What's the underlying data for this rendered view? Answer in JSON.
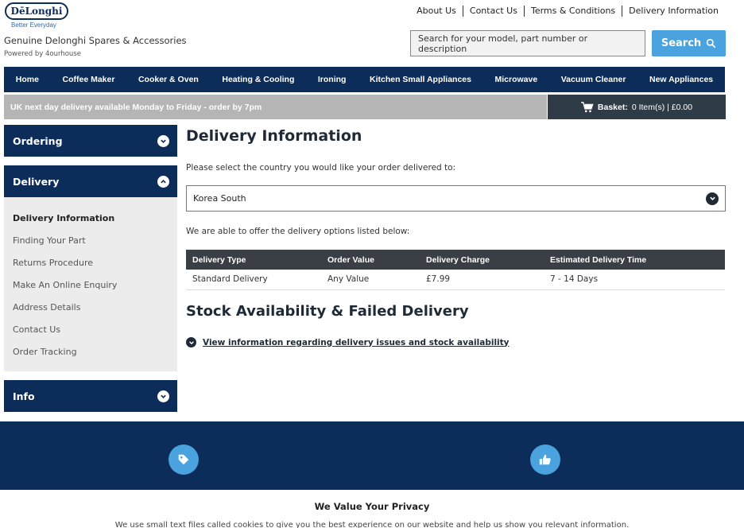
{
  "brand": {
    "logo_text": "DēLonghi",
    "tagline": "Better Everyday",
    "site_name": "Genuine Delonghi Spares & Accessories",
    "powered_by": "Powered by 4ourhouse"
  },
  "top_links": [
    "About Us",
    "Contact Us",
    "Terms & Conditions",
    "Delivery Information"
  ],
  "search": {
    "placeholder": "Search for your model, part number or description",
    "button_label": "Search"
  },
  "nav": [
    "Home",
    "Coffee Maker",
    "Cooker & Oven",
    "Heating & Cooling",
    "Ironing",
    "Kitchen Small Appliances",
    "Microwave",
    "Vacuum Cleaner",
    "New Appliances"
  ],
  "promo": "UK next day delivery available Monday to Friday - order by 7pm",
  "basket": {
    "label": "Basket:",
    "summary": "0 Item(s) | £0.00"
  },
  "sidebar": {
    "ordering": "Ordering",
    "delivery": "Delivery",
    "info": "Info",
    "delivery_items": [
      "Delivery Information",
      "Finding Your Part",
      "Returns Procedure",
      "Make An Online Enquiry",
      "Address Details",
      "Contact Us",
      "Order Tracking"
    ]
  },
  "main": {
    "title": "Delivery Information",
    "select_prompt": "Please select the country you would like your order delivered to:",
    "country": "Korea South",
    "options_intro": "We are able to offer the delivery options listed below:",
    "table": {
      "headers": [
        "Delivery Type",
        "Order Value",
        "Delivery Charge",
        "Estimated Delivery Time"
      ],
      "rows": [
        [
          "Standard Delivery",
          "Any Value",
          "£7.99",
          "7 - 14 Days"
        ]
      ]
    },
    "stock_title": "Stock Availability & Failed Delivery",
    "stock_link": "View information regarding delivery issues and stock availability"
  },
  "privacy": {
    "title": "We Value Your Privacy",
    "text": "We use small text files called cookies to give you the best experience on our website and help us show you relevant information."
  },
  "colors": {
    "navy": "#0c2d5a",
    "accent": "#4aa3df",
    "promo_grey": "#b5b5b5",
    "basket_bg": "#2f3b47"
  }
}
